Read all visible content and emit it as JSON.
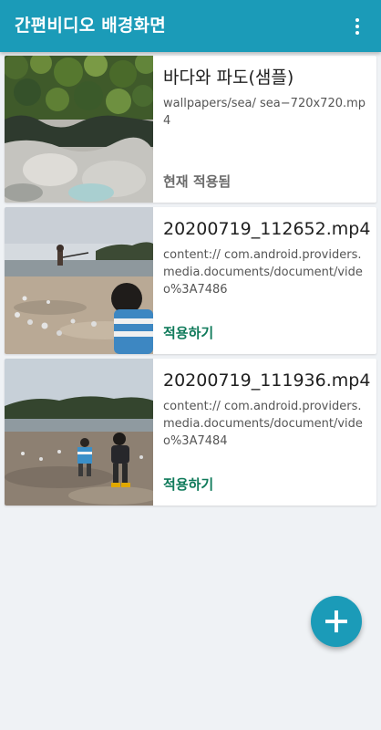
{
  "appbar": {
    "title": "간편비디오 배경화면",
    "menu_icon": "more-vert-icon"
  },
  "colors": {
    "primary": "#1b9bb8",
    "apply_text": "#0f7a5a",
    "current_text": "#6b6b6b",
    "background": "#eff2f5"
  },
  "videos": [
    {
      "title": "바다와 파도(샘플)",
      "path": "wallpapers/sea/ sea−720x720.mp4",
      "status": "현재 적용됨"
    },
    {
      "title": "20200719_112652.mp4",
      "path": "content:// com.android.providers.media.documents/document/video%3A7486",
      "status": "적용하기"
    },
    {
      "title": "20200719_111936.mp4",
      "path": "content:// com.android.providers.media.documents/document/video%3A7484",
      "status": "적용하기"
    }
  ],
  "fab": {
    "icon": "plus-icon"
  }
}
